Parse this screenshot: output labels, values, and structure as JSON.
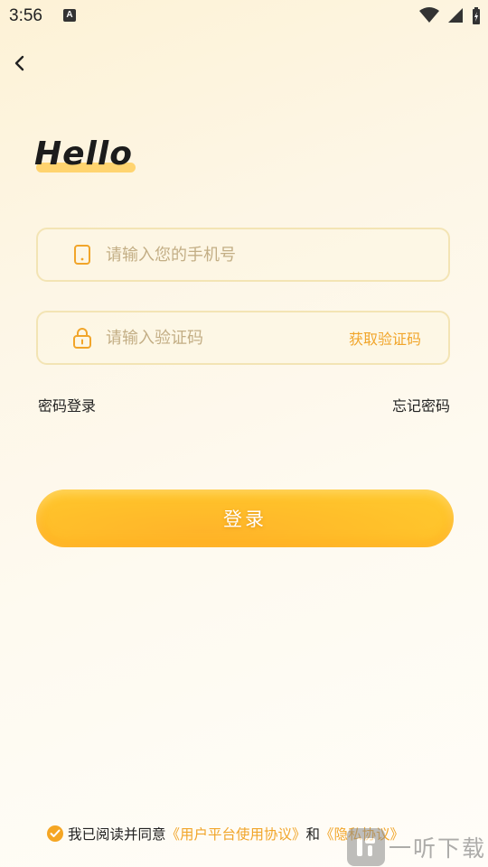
{
  "status_bar": {
    "time": "3:56",
    "notification_letter": "A"
  },
  "greeting": "Hello",
  "phone_field": {
    "value": "",
    "placeholder": "请输入您的手机号"
  },
  "code_field": {
    "value": "",
    "placeholder": "请输入验证码",
    "get_code_label": "获取验证码"
  },
  "links": {
    "password_login": "密码登录",
    "forgot_password": "忘记密码"
  },
  "login_button": {
    "label": "登录"
  },
  "agreement": {
    "checked": true,
    "prefix": "我已阅读并同意",
    "user_agreement": "《用户平台使用协议》",
    "conjunction": "和",
    "privacy_policy": "《隐私协议》"
  },
  "watermark": {
    "text": "一听下载"
  },
  "colors": {
    "accent": "#f5a623",
    "button": "#ffbf2a",
    "field_border": "#f3e4b4",
    "placeholder": "#c3ae85"
  }
}
